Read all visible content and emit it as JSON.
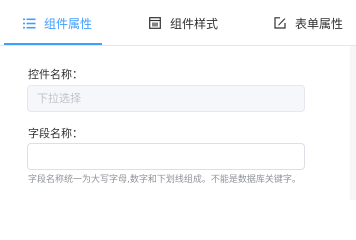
{
  "tabs": [
    {
      "label": "组件属性",
      "icon": "list-icon",
      "active": true
    },
    {
      "label": "组件样式",
      "icon": "style-icon",
      "active": false
    },
    {
      "label": "表单属性",
      "icon": "edit-icon",
      "active": false
    }
  ],
  "fields": {
    "control_name": {
      "label": "控件名称：",
      "placeholder": "下拉选择",
      "value": ""
    },
    "field_name": {
      "label": "字段名称：",
      "placeholder": "",
      "value": "",
      "hint": "字段名称统一为大写字母,数字和下划线组成。不能是数据库关键字。"
    }
  },
  "colors": {
    "accent": "#409eff",
    "border": "#dcdfe6",
    "hint": "#909399"
  }
}
